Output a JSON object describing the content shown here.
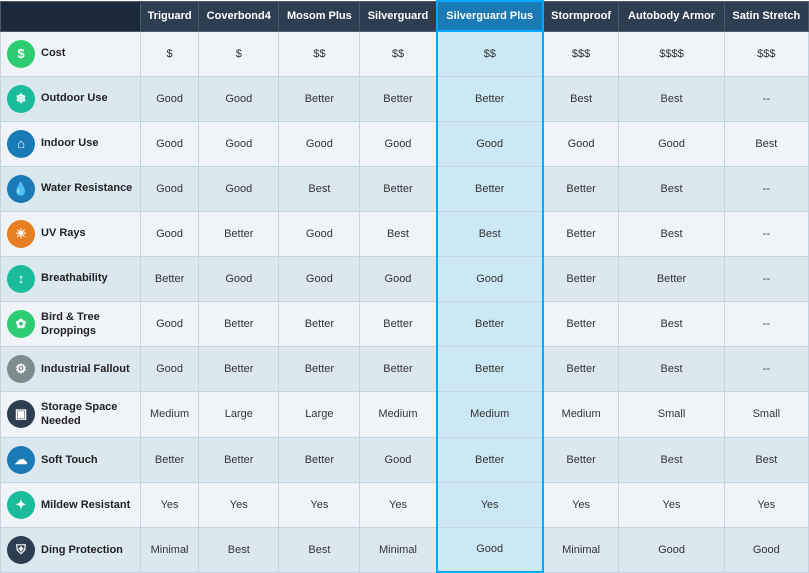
{
  "header": {
    "feature_col": "",
    "columns": [
      {
        "id": "triguard",
        "label": "Triguard",
        "highlight": false
      },
      {
        "id": "coverbond4",
        "label": "Coverbond4",
        "highlight": false
      },
      {
        "id": "mosom_plus",
        "label": "Mosom Plus",
        "highlight": false
      },
      {
        "id": "silverguard",
        "label": "Silverguard",
        "highlight": false
      },
      {
        "id": "silverguard_plus",
        "label": "Silverguard Plus",
        "highlight": true
      },
      {
        "id": "stormproof",
        "label": "Stormproof",
        "highlight": false
      },
      {
        "id": "autobody_armor",
        "label": "Autobody Armor",
        "highlight": false
      },
      {
        "id": "satin_stretch",
        "label": "Satin Stretch",
        "highlight": false
      }
    ]
  },
  "rows": [
    {
      "feature": "Cost",
      "icon": "$",
      "icon_class": "green",
      "values": [
        "$",
        "$",
        "$$",
        "$$",
        "$$",
        "$$$",
        "$$$$",
        "$$$"
      ]
    },
    {
      "feature": "Outdoor Use",
      "icon": "❄",
      "icon_class": "teal",
      "values": [
        "Good",
        "Good",
        "Better",
        "Better",
        "Better",
        "Best",
        "Best",
        "--"
      ]
    },
    {
      "feature": "Indoor Use",
      "icon": "🏠",
      "icon_class": "blue",
      "values": [
        "Good",
        "Good",
        "Good",
        "Good",
        "Good",
        "Good",
        "Good",
        "Best"
      ]
    },
    {
      "feature": "Water Resistance",
      "icon": "💧",
      "icon_class": "blue",
      "values": [
        "Good",
        "Good",
        "Best",
        "Better",
        "Better",
        "Better",
        "Best",
        "--"
      ]
    },
    {
      "feature": "UV Rays",
      "icon": "☀",
      "icon_class": "orange",
      "values": [
        "Good",
        "Better",
        "Good",
        "Best",
        "Best",
        "Better",
        "Best",
        "--"
      ]
    },
    {
      "feature": "Breathability",
      "icon": "↕",
      "icon_class": "teal",
      "values": [
        "Better",
        "Good",
        "Good",
        "Good",
        "Good",
        "Better",
        "Better",
        "--"
      ]
    },
    {
      "feature": "Bird & Tree Droppings",
      "icon": "🍃",
      "icon_class": "green",
      "values": [
        "Good",
        "Better",
        "Better",
        "Better",
        "Better",
        "Better",
        "Best",
        "--"
      ]
    },
    {
      "feature": "Industrial Fallout",
      "icon": "⚙",
      "icon_class": "gray",
      "values": [
        "Good",
        "Better",
        "Better",
        "Better",
        "Better",
        "Better",
        "Best",
        "--"
      ]
    },
    {
      "feature": "Storage Space Needed",
      "icon": "▣",
      "icon_class": "dark",
      "values": [
        "Medium",
        "Large",
        "Large",
        "Medium",
        "Medium",
        "Medium",
        "Small",
        "Small"
      ]
    },
    {
      "feature": "Soft Touch",
      "icon": "☁",
      "icon_class": "blue",
      "values": [
        "Better",
        "Better",
        "Better",
        "Good",
        "Better",
        "Better",
        "Best",
        "Best"
      ]
    },
    {
      "feature": "Mildew Resistant",
      "icon": "✦",
      "icon_class": "teal",
      "values": [
        "Yes",
        "Yes",
        "Yes",
        "Yes",
        "Yes",
        "Yes",
        "Yes",
        "Yes"
      ]
    },
    {
      "feature": "Ding Protection",
      "icon": "🛡",
      "icon_class": "navy",
      "values": [
        "Minimal",
        "Best",
        "Best",
        "Minimal",
        "Good",
        "Minimal",
        "Good",
        "Good"
      ]
    }
  ],
  "highlight_col_index": 4
}
